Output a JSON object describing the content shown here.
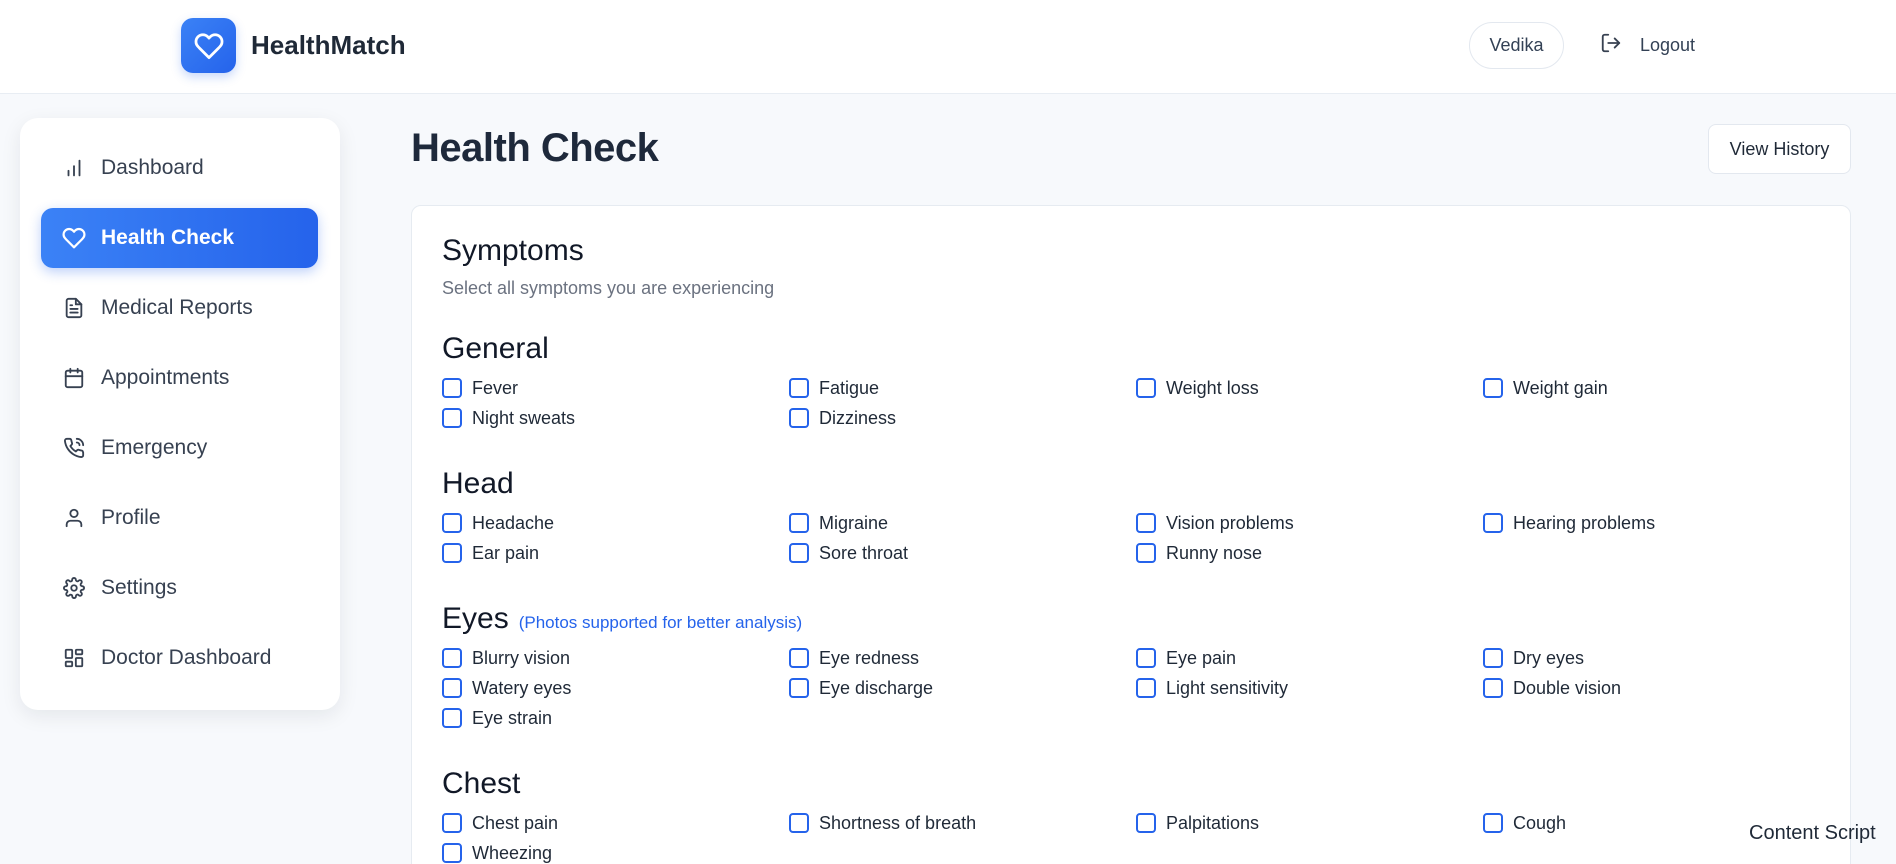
{
  "header": {
    "brand": "HealthMatch",
    "user": "Vedika",
    "logout": "Logout"
  },
  "sidebar": {
    "items": [
      {
        "label": "Dashboard",
        "icon": "bar-chart-icon",
        "active": false
      },
      {
        "label": "Health Check",
        "icon": "heart-icon",
        "active": true
      },
      {
        "label": "Medical Reports",
        "icon": "file-text-icon",
        "active": false
      },
      {
        "label": "Appointments",
        "icon": "calendar-icon",
        "active": false
      },
      {
        "label": "Emergency",
        "icon": "phone-call-icon",
        "active": false
      },
      {
        "label": "Profile",
        "icon": "user-icon",
        "active": false
      },
      {
        "label": "Settings",
        "icon": "gear-icon",
        "active": false
      },
      {
        "label": "Doctor Dashboard",
        "icon": "grid-icon",
        "active": false
      }
    ]
  },
  "main": {
    "title": "Health Check",
    "view_history": "View History",
    "card": {
      "title": "Symptoms",
      "subtitle": "Select all symptoms you are experiencing",
      "groups": [
        {
          "title": "General",
          "note": "",
          "options": [
            "Fever",
            "Fatigue",
            "Weight loss",
            "Weight gain",
            "Night sweats",
            "Dizziness"
          ]
        },
        {
          "title": "Head",
          "note": "",
          "options": [
            "Headache",
            "Migraine",
            "Vision problems",
            "Hearing problems",
            "Ear pain",
            "Sore throat",
            "Runny nose"
          ]
        },
        {
          "title": "Eyes",
          "note": "(Photos supported for better analysis)",
          "options": [
            "Blurry vision",
            "Eye redness",
            "Eye pain",
            "Dry eyes",
            "Watery eyes",
            "Eye discharge",
            "Light sensitivity",
            "Double vision",
            "Eye strain"
          ]
        },
        {
          "title": "Chest",
          "note": "",
          "options": [
            "Chest pain",
            "Shortness of breath",
            "Palpitations",
            "Cough",
            "Wheezing"
          ]
        }
      ]
    }
  },
  "footer": {
    "content_script": "Content Script"
  },
  "colors": {
    "accent": "#2563eb",
    "accent_light": "#3b82f6"
  }
}
